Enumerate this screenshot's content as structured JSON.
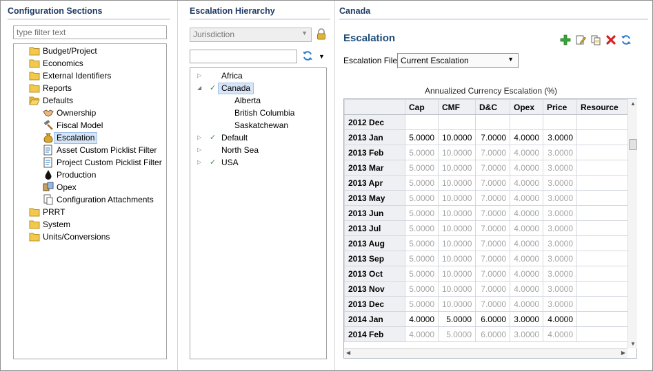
{
  "left": {
    "title": "Configuration Sections",
    "filter_placeholder": "type filter text",
    "items": [
      {
        "label": "Budget/Project",
        "icon": "folder-icon",
        "level": 0
      },
      {
        "label": "Economics",
        "icon": "folder-icon",
        "level": 0
      },
      {
        "label": "External Identifiers",
        "icon": "folder-icon",
        "level": 0
      },
      {
        "label": "Reports",
        "icon": "folder-icon",
        "level": 0
      },
      {
        "label": "Defaults",
        "icon": "folder-open-icon",
        "level": 0
      },
      {
        "label": "Ownership",
        "icon": "handshake-icon",
        "level": 1
      },
      {
        "label": "Fiscal Model",
        "icon": "hammer-icon",
        "level": 1
      },
      {
        "label": "Escalation",
        "icon": "money-bag-icon",
        "level": 1,
        "selected": true
      },
      {
        "label": "Asset Custom Picklist Filter",
        "icon": "picklist-icon",
        "level": 1
      },
      {
        "label": "Project Custom Picklist Filter",
        "icon": "picklist-icon",
        "level": 1
      },
      {
        "label": "Production",
        "icon": "oil-drop-icon",
        "level": 1
      },
      {
        "label": "Opex",
        "icon": "opex-icon",
        "level": 1
      },
      {
        "label": "Configuration Attachments",
        "icon": "attachment-icon",
        "level": 1
      },
      {
        "label": "PRRT",
        "icon": "folder-icon",
        "level": 0
      },
      {
        "label": "System",
        "icon": "folder-icon",
        "level": 0
      },
      {
        "label": "Units/Conversions",
        "icon": "folder-icon",
        "level": 0
      }
    ]
  },
  "middle": {
    "title": "Escalation Hierarchy",
    "jurisdiction": "Jurisdiction",
    "search_value": "",
    "nodes": [
      {
        "label": "Africa",
        "expand": "collapsed",
        "checked": false,
        "child": false
      },
      {
        "label": "Canada",
        "expand": "expanded",
        "checked": true,
        "child": false,
        "selected": true
      },
      {
        "label": "Alberta",
        "expand": "none",
        "checked": false,
        "child": true
      },
      {
        "label": "British Columbia",
        "expand": "none",
        "checked": false,
        "child": true
      },
      {
        "label": "Saskatchewan",
        "expand": "none",
        "checked": false,
        "child": true
      },
      {
        "label": "Default",
        "expand": "collapsed",
        "checked": true,
        "child": false
      },
      {
        "label": "North Sea",
        "expand": "collapsed",
        "checked": false,
        "child": false
      },
      {
        "label": "USA",
        "expand": "collapsed",
        "checked": true,
        "child": false
      }
    ]
  },
  "right": {
    "title": "Canada",
    "heading": "Escalation",
    "file_label": "Escalation File",
    "file_value": "Current Escalation",
    "table_caption": "Annualized Currency Escalation (%)",
    "columns": [
      "",
      "Cap",
      "CMF",
      "D&C",
      "Opex",
      "Price",
      "Resource"
    ],
    "rows": [
      {
        "label": "2012 Dec",
        "values": [
          "",
          "",
          "",
          "",
          "",
          ""
        ],
        "editable": true
      },
      {
        "label": "2013 Jan",
        "values": [
          "5.0000",
          "10.0000",
          "7.0000",
          "4.0000",
          "3.0000",
          ""
        ],
        "editable": true
      },
      {
        "label": "2013 Feb",
        "values": [
          "5.0000",
          "10.0000",
          "7.0000",
          "4.0000",
          "3.0000",
          ""
        ],
        "editable": false
      },
      {
        "label": "2013 Mar",
        "values": [
          "5.0000",
          "10.0000",
          "7.0000",
          "4.0000",
          "3.0000",
          ""
        ],
        "editable": false
      },
      {
        "label": "2013 Apr",
        "values": [
          "5.0000",
          "10.0000",
          "7.0000",
          "4.0000",
          "3.0000",
          ""
        ],
        "editable": false
      },
      {
        "label": "2013 May",
        "values": [
          "5.0000",
          "10.0000",
          "7.0000",
          "4.0000",
          "3.0000",
          ""
        ],
        "editable": false
      },
      {
        "label": "2013 Jun",
        "values": [
          "5.0000",
          "10.0000",
          "7.0000",
          "4.0000",
          "3.0000",
          ""
        ],
        "editable": false
      },
      {
        "label": "2013 Jul",
        "values": [
          "5.0000",
          "10.0000",
          "7.0000",
          "4.0000",
          "3.0000",
          ""
        ],
        "editable": false
      },
      {
        "label": "2013 Aug",
        "values": [
          "5.0000",
          "10.0000",
          "7.0000",
          "4.0000",
          "3.0000",
          ""
        ],
        "editable": false
      },
      {
        "label": "2013 Sep",
        "values": [
          "5.0000",
          "10.0000",
          "7.0000",
          "4.0000",
          "3.0000",
          ""
        ],
        "editable": false
      },
      {
        "label": "2013 Oct",
        "values": [
          "5.0000",
          "10.0000",
          "7.0000",
          "4.0000",
          "3.0000",
          ""
        ],
        "editable": false
      },
      {
        "label": "2013 Nov",
        "values": [
          "5.0000",
          "10.0000",
          "7.0000",
          "4.0000",
          "3.0000",
          ""
        ],
        "editable": false
      },
      {
        "label": "2013 Dec",
        "values": [
          "5.0000",
          "10.0000",
          "7.0000",
          "4.0000",
          "3.0000",
          ""
        ],
        "editable": false
      },
      {
        "label": "2014 Jan",
        "values": [
          "4.0000",
          "5.0000",
          "6.0000",
          "3.0000",
          "4.0000",
          ""
        ],
        "editable": true
      },
      {
        "label": "2014 Feb",
        "values": [
          "4.0000",
          "5.0000",
          "6.0000",
          "3.0000",
          "4.0000",
          ""
        ],
        "editable": false
      }
    ]
  }
}
